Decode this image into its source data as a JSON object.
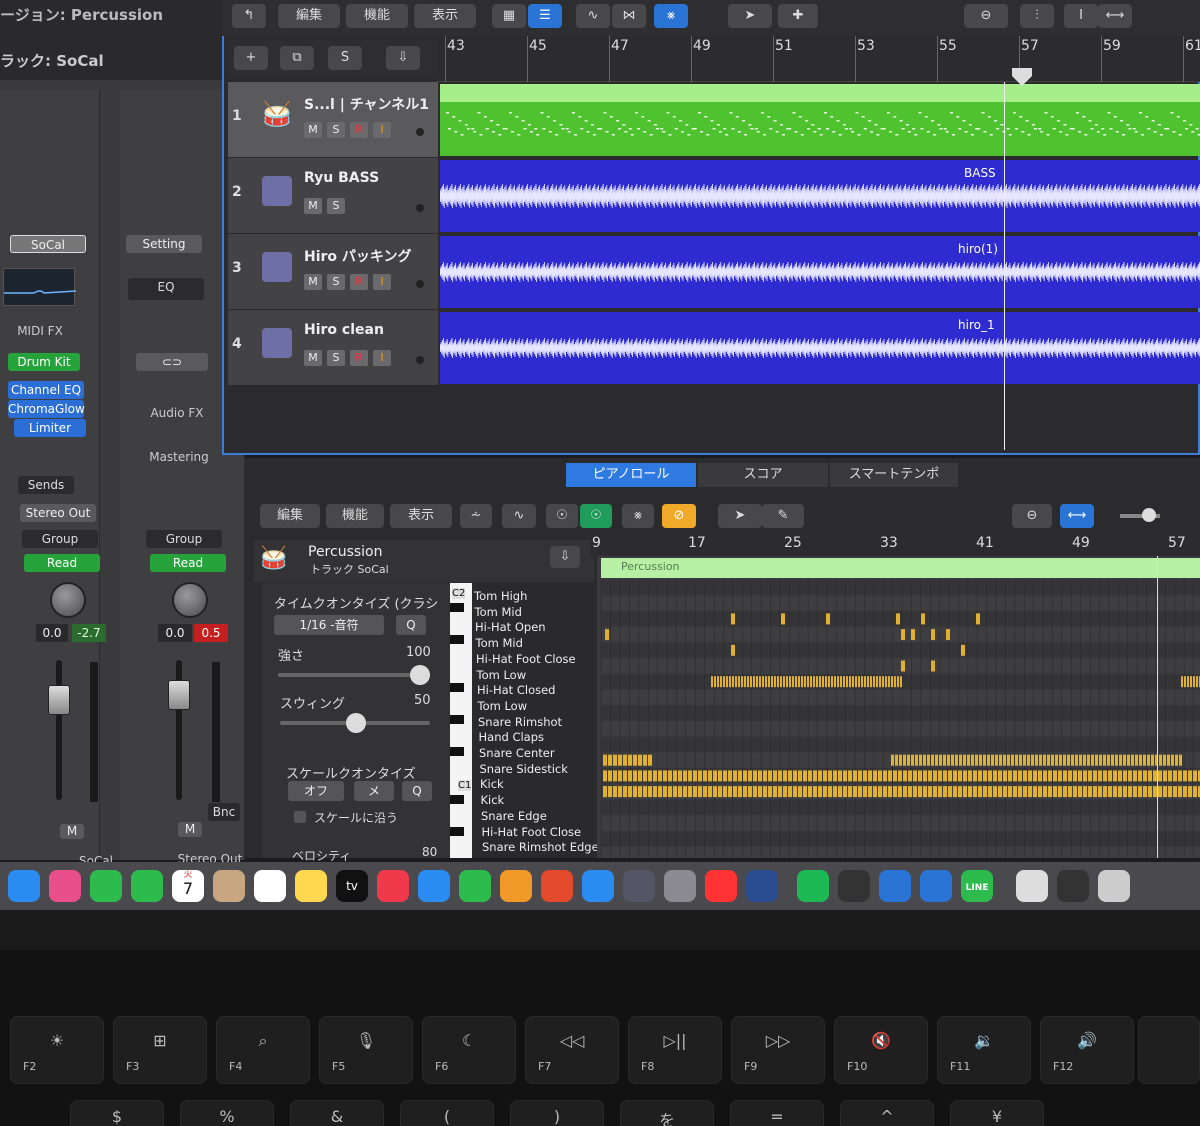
{
  "window": {
    "title": "ージョン: Percussion",
    "track_label": "ラック: SoCal"
  },
  "toolbar": {
    "menus": [
      "編集",
      "機能",
      "表示"
    ],
    "header_buttons": [
      "+",
      "S"
    ]
  },
  "ruler": {
    "bars": [
      "43",
      "45",
      "47",
      "49",
      "51",
      "53",
      "55",
      "57",
      "59",
      "61"
    ]
  },
  "tracks": [
    {
      "number": "1",
      "name": "S...l | チャンネル1",
      "buttons": [
        "M",
        "S",
        "R",
        "I"
      ],
      "region": "",
      "color": "#4fc22f"
    },
    {
      "number": "2",
      "name": "Ryu BASS",
      "buttons": [
        "M",
        "S"
      ],
      "region": "BASS",
      "color": "#2e2bd0"
    },
    {
      "number": "3",
      "name": "Hiro パッキング",
      "buttons": [
        "M",
        "S",
        "R",
        "I"
      ],
      "region": "hiro(1)",
      "color": "#2e2bd0"
    },
    {
      "number": "4",
      "name": "Hiro clean",
      "buttons": [
        "M",
        "S",
        "R",
        "I"
      ],
      "region": "hiro_1",
      "color": "#2e2bd0"
    }
  ],
  "inspector": {
    "strip1": {
      "setting": "SoCal",
      "midi_fx": "MIDI FX",
      "instrument": "Drum Kit",
      "plugins": [
        "Channel EQ",
        "ChromaGlow",
        "Limiter"
      ],
      "sends": "Sends",
      "output": "Stereo Out",
      "group": "Group",
      "automation": "Read",
      "values": [
        "0.0",
        "-2.7"
      ],
      "mute": "M",
      "solo": "S",
      "name": "SoCal"
    },
    "strip2": {
      "setting": "Setting",
      "eq": "EQ",
      "audio_fx": "Audio FX",
      "mastering": "Mastering",
      "group": "Group",
      "automation": "Read",
      "values": [
        "0.0",
        "0.5"
      ],
      "bounce": "Bnc",
      "mute": "M",
      "name": "Stereo Out"
    },
    "meter_scale": [
      "0",
      "3",
      "6",
      "9",
      "12",
      "15",
      "18",
      "21",
      "24",
      "30",
      "35",
      "40",
      "45",
      "50",
      "60"
    ]
  },
  "editor": {
    "tabs": [
      "ピアノロール",
      "スコア",
      "スマートテンポ"
    ],
    "menus": [
      "編集",
      "機能",
      "表示"
    ],
    "region_title": "Percussion",
    "region_subtitle": "トラック SoCal",
    "time_quantize_label": "タイムクオンタイズ (クラシ",
    "time_quantize_value": "1/16 -音符",
    "q_button": "Q",
    "strength_label": "強さ",
    "strength_value": "100",
    "swing_label": "スウィング",
    "swing_value": "50",
    "scale_quantize_label": "スケールクオンタイズ",
    "scale_off": "オフ",
    "scale_minor": "メ",
    "scale_checkbox": "スケールに沿う",
    "velocity_label": "ベロシティ",
    "velocity_value": "80",
    "ruler": [
      "9",
      "17",
      "25",
      "33",
      "41",
      "49",
      "57"
    ],
    "region_name": "Percussion",
    "key_labels": [
      "C2",
      "C1"
    ],
    "drum_names": [
      "Tom High",
      "Tom Mid",
      "Hi-Hat Open",
      "Tom Mid",
      "Hi-Hat Foot Close",
      "Tom Low",
      "Hi-Hat Closed",
      "Tom Low",
      "Snare Rimshot",
      "Hand Claps",
      "Snare Center",
      "Snare Sidestick",
      "Kick",
      "Kick",
      "Snare Edge",
      "Hi-Hat Foot Close",
      "Snare Rimshot Edge"
    ]
  },
  "dock": {
    "apps": [
      "finder-icon",
      "photos-icon",
      "facetime-icon",
      "phone-icon",
      "calendar-icon",
      "contacts-icon",
      "reminders-icon",
      "notes-icon",
      "appletv-icon",
      "music-icon",
      "keynote-icon",
      "numbers-icon",
      "pages-icon",
      "rocket-icon",
      "appstore-icon",
      "simulator-icon",
      "settings-icon",
      "youtube-icon",
      "logic-icon",
      "spotify-icon",
      "mainstage-icon",
      "app-icon",
      "q-icon",
      "line-icon",
      "music-file-icon",
      "folder-icon",
      "trash-icon"
    ],
    "calendar_month": "火",
    "calendar_day": "7",
    "tv_label": "tv",
    "line_label": "LINE"
  },
  "keyboard": {
    "keys": [
      {
        "sym": "☀",
        "fn": "F2"
      },
      {
        "sym": "⊞",
        "fn": "F3"
      },
      {
        "sym": "⌕",
        "fn": "F4"
      },
      {
        "sym": "🎙",
        "fn": "F5"
      },
      {
        "sym": "☾",
        "fn": "F6"
      },
      {
        "sym": "◁◁",
        "fn": "F7"
      },
      {
        "sym": "▷||",
        "fn": "F8"
      },
      {
        "sym": "▷▷",
        "fn": "F9"
      },
      {
        "sym": "🔇",
        "fn": "F10"
      },
      {
        "sym": "🔉",
        "fn": "F11"
      },
      {
        "sym": "🔊",
        "fn": "F12"
      }
    ],
    "bottom_row": [
      "$",
      "%",
      "&",
      "(",
      ")",
      "を",
      "=",
      "^",
      "¥"
    ]
  }
}
